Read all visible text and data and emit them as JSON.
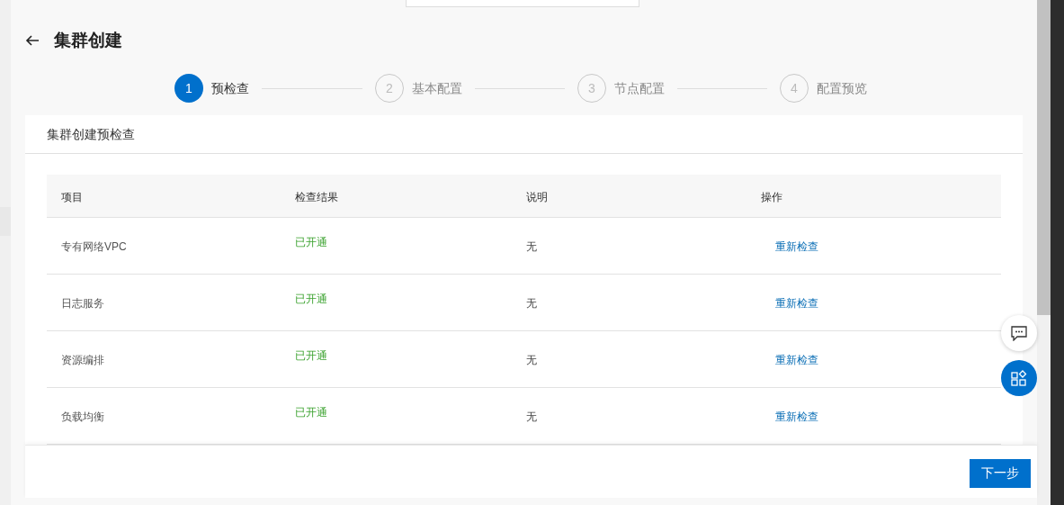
{
  "page_title": "集群创建",
  "steps": [
    {
      "number": "1",
      "label": "预检查",
      "selected": true
    },
    {
      "number": "2",
      "label": "基本配置",
      "selected": false
    },
    {
      "number": "3",
      "label": "节点配置",
      "selected": false
    },
    {
      "number": "4",
      "label": "配置预览",
      "selected": false
    }
  ],
  "card_title": "集群创建预检查",
  "table": {
    "columns": [
      "项目",
      "检查结果",
      "说明",
      "操作"
    ],
    "rows": [
      {
        "item": "专有网络VPC",
        "result": "已开通",
        "note": "无",
        "action": "重新检查"
      },
      {
        "item": "日志服务",
        "result": "已开通",
        "note": "无",
        "action": "重新检查"
      },
      {
        "item": "资源编排",
        "result": "已开通",
        "note": "无",
        "action": "重新检查"
      },
      {
        "item": "负载均衡",
        "result": "已开通",
        "note": "无",
        "action": "重新检查"
      }
    ]
  },
  "next_button": "下一步"
}
